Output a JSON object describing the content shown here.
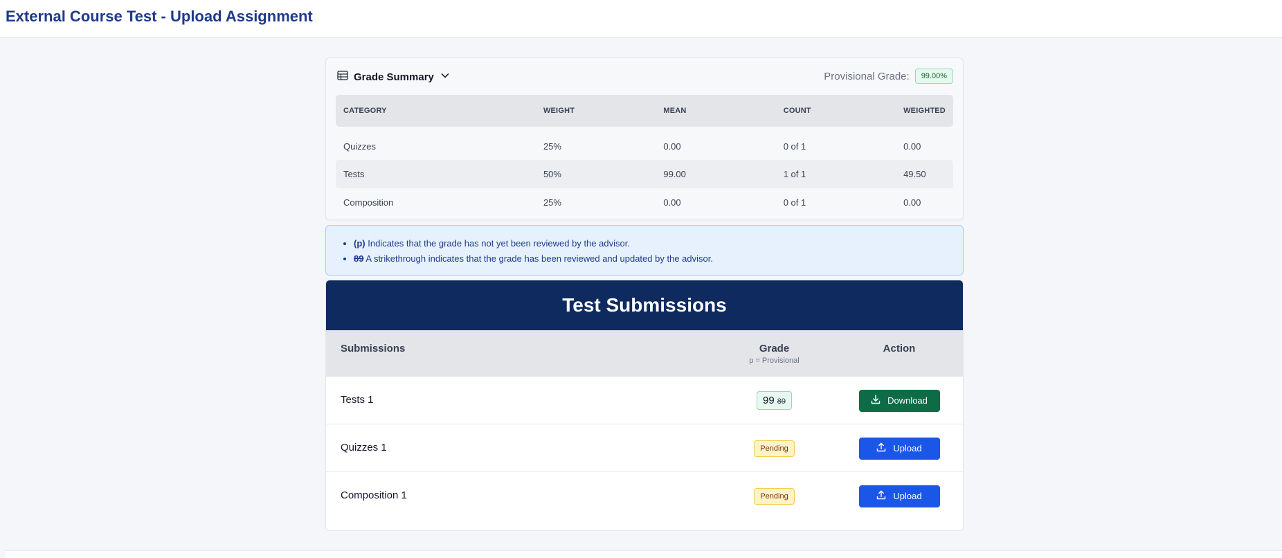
{
  "header": {
    "title": "External Course Test - Upload Assignment"
  },
  "grade_summary": {
    "title": "Grade Summary",
    "title_icon": "table-icon",
    "toggle_icon": "chevron-down-icon",
    "provisional_label": "Provisional Grade:",
    "provisional_value": "99.00%",
    "columns": [
      "CATEGORY",
      "WEIGHT",
      "MEAN",
      "COUNT",
      "WEIGHTED"
    ],
    "rows": [
      [
        "Quizzes",
        "25%",
        "0.00",
        "0 of 1",
        "0.00"
      ],
      [
        "Tests",
        "50%",
        "99.00",
        "1 of 1",
        "49.50"
      ],
      [
        "Composition",
        "25%",
        "0.00",
        "0 of 1",
        "0.00"
      ]
    ]
  },
  "legend": {
    "p_marker": "(p)",
    "p_text": "Indicates that the grade has not yet been reviewed by the advisor.",
    "strike_marker": "89",
    "strike_text": "A strikethrough indicates that the grade has been reviewed and updated by the advisor."
  },
  "submissions": {
    "title": "Test Submissions",
    "col_submissions": "Submissions",
    "col_grade": "Grade",
    "col_grade_note": "p = Provisional",
    "col_action": "Action",
    "rows": [
      {
        "name": "Tests 1",
        "grade": "99",
        "old_grade": "89",
        "status": "",
        "action": "Download",
        "action_icon": "download-icon"
      },
      {
        "name": "Quizzes 1",
        "grade": "",
        "old_grade": "",
        "status": "Pending",
        "action": "Upload",
        "action_icon": "upload-icon"
      },
      {
        "name": "Composition 1",
        "grade": "",
        "old_grade": "",
        "status": "Pending",
        "action": "Upload",
        "action_icon": "upload-icon"
      }
    ]
  },
  "colors": {
    "title": "#1e3a8a",
    "banner": "#0f2a5f",
    "download_button": "#0d6b46",
    "upload_button": "#1a56e8",
    "grade_badge": "#e7f8ef",
    "pending_badge": "#fef3c7"
  }
}
